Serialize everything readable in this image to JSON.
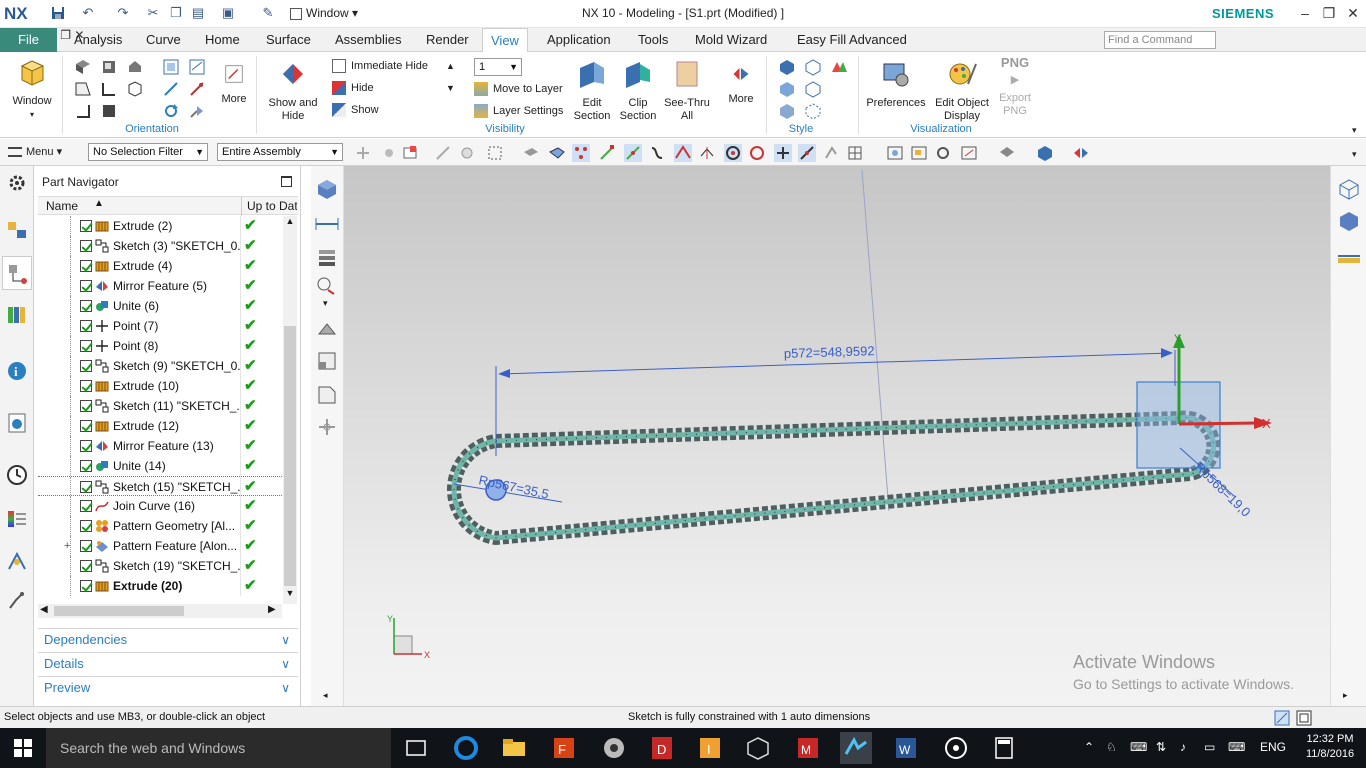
{
  "titlebar": {
    "logo": "NX",
    "window_menu": "Window",
    "title": "NX 10 - Modeling - [S1.prt (Modified) ]",
    "brand": "SIEMENS"
  },
  "tabs": {
    "file": "File",
    "items": [
      "Analysis",
      "Curve",
      "Home",
      "Surface",
      "Assemblies",
      "Render",
      "View",
      "Application",
      "Tools",
      "Mold Wizard",
      "Easy Fill Advanced"
    ],
    "active": "View",
    "find_placeholder": "Find a Command"
  },
  "ribbon": {
    "window_btn": "Window",
    "orientation_more": "More",
    "orientation_label": "Orientation",
    "show_hide": "Show and Hide",
    "immediate_hide": "Immediate Hide",
    "hide": "Hide",
    "show": "Show",
    "layer_value": "1",
    "move_to_layer": "Move to Layer",
    "layer_settings": "Layer Settings",
    "edit_section": "Edit Section",
    "clip_section": "Clip Section",
    "see_thru_all": "See-Thru All",
    "visibility_more": "More",
    "visibility_label": "Visibility",
    "style_label": "Style",
    "preferences": "Preferences",
    "edit_object_display": "Edit Object Display",
    "export_png_top": "PNG",
    "export_png": "Export PNG",
    "visualization_label": "Visualization"
  },
  "toolbar": {
    "menu": "Menu",
    "selection_filter": "No Selection Filter",
    "assembly_scope": "Entire Assembly"
  },
  "navigator": {
    "title": "Part Navigator",
    "col_name": "Name",
    "col_uptodate": "Up to Date",
    "rows": [
      {
        "label": "Extrude (2)",
        "icon": "extrude-icon"
      },
      {
        "label": "Sketch (3) \"SKETCH_0...",
        "icon": "sketch-icon"
      },
      {
        "label": "Extrude (4)",
        "icon": "extrude-icon"
      },
      {
        "label": "Mirror Feature (5)",
        "icon": "mirror-icon"
      },
      {
        "label": "Unite (6)",
        "icon": "unite-icon"
      },
      {
        "label": "Point (7)",
        "icon": "point-icon"
      },
      {
        "label": "Point (8)",
        "icon": "point-icon"
      },
      {
        "label": "Sketch (9) \"SKETCH_0...",
        "icon": "sketch-icon"
      },
      {
        "label": "Extrude (10)",
        "icon": "extrude-icon"
      },
      {
        "label": "Sketch (11) \"SKETCH_...",
        "icon": "sketch-icon"
      },
      {
        "label": "Extrude (12)",
        "icon": "extrude-icon"
      },
      {
        "label": "Mirror Feature (13)",
        "icon": "mirror-icon"
      },
      {
        "label": "Unite (14)",
        "icon": "unite-icon"
      },
      {
        "label": "Sketch (15) \"SKETCH_...",
        "icon": "sketch-icon"
      },
      {
        "label": "Join Curve (16)",
        "icon": "join-curve-icon"
      },
      {
        "label": "Pattern Geometry [Al...",
        "icon": "pattern-icon"
      },
      {
        "label": "Pattern Feature [Alon...",
        "icon": "pattern-feature-icon"
      },
      {
        "label": "Sketch (19) \"SKETCH_...",
        "icon": "sketch-icon"
      },
      {
        "label": "Extrude (20)",
        "icon": "extrude-icon"
      }
    ],
    "sections": [
      "Dependencies",
      "Details",
      "Preview"
    ]
  },
  "graphics": {
    "dim_linear": "p572=548,9592",
    "dim_radius_left": "Rp567=35,5",
    "dim_radius_right": "Rp568=19,0",
    "axis_x": "X",
    "axis_y": "Y",
    "watermark_title": "Activate Windows",
    "watermark_sub": "Go to Settings to activate Windows."
  },
  "status": {
    "left": "Select objects and use MB3, or double-click an object",
    "middle": "Sketch is fully constrained with 1 auto dimensions"
  },
  "taskbar": {
    "search": "Search the web and Windows",
    "lang": "ENG",
    "time": "12:32 PM",
    "date": "11/8/2016"
  }
}
